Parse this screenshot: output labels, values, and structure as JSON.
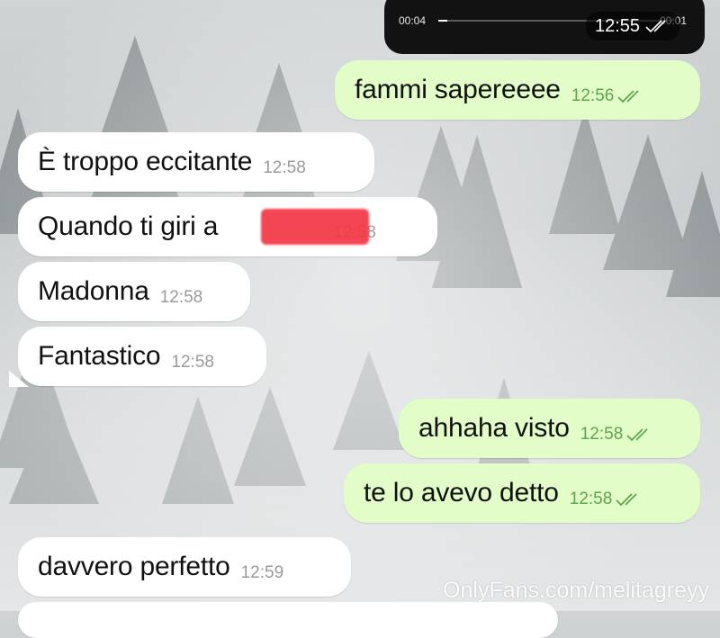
{
  "media_player": {
    "elapsed": "00:04",
    "remaining": "00:01",
    "timestamp": "12:55"
  },
  "messages": [
    {
      "dir": "out",
      "text": "fammi sapereeee",
      "time": "12:56",
      "read": true
    },
    {
      "dir": "in",
      "text": "È troppo eccitante",
      "time": "12:58"
    },
    {
      "dir": "in",
      "text": "Quando ti giri a",
      "time": "12:58",
      "redacted": true
    },
    {
      "dir": "in",
      "text": "Madonna",
      "time": "12:58"
    },
    {
      "dir": "in",
      "text": "Fantastico",
      "time": "12:58"
    },
    {
      "dir": "out",
      "text": "ahhaha visto",
      "time": "12:58",
      "read": true
    },
    {
      "dir": "out",
      "text": "te lo avevo detto",
      "time": "12:58",
      "read": true
    },
    {
      "dir": "in",
      "text": "davvero perfetto",
      "time": "12:59"
    }
  ],
  "watermark": "OnlyFans.com/melitagreyy",
  "colors": {
    "outgoing_bubble": "#e2fdc7",
    "incoming_bubble": "#ffffff",
    "outgoing_time": "#5ea34d",
    "redaction": "#f43846"
  }
}
